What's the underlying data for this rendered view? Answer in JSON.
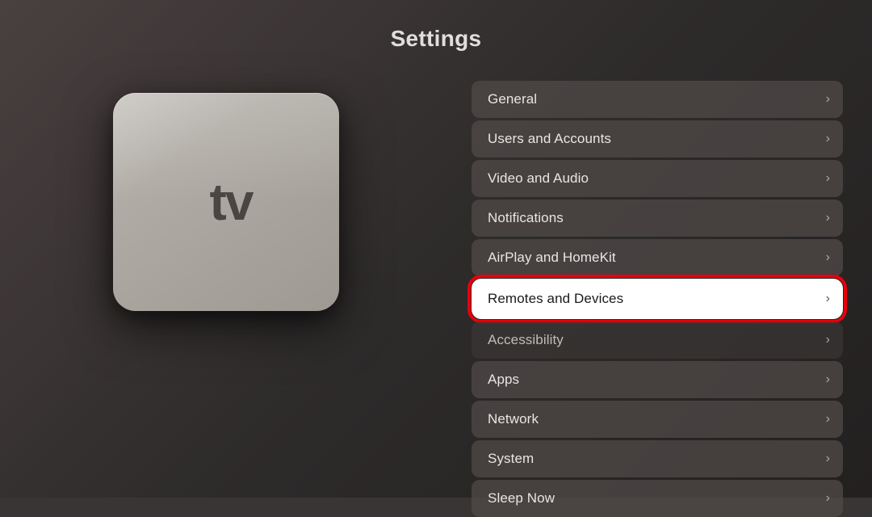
{
  "page": {
    "title": "Settings"
  },
  "settings": {
    "items": [
      {
        "id": "general",
        "label": "General",
        "highlighted": false,
        "dimmed": false
      },
      {
        "id": "users-and-accounts",
        "label": "Users and Accounts",
        "highlighted": false,
        "dimmed": false
      },
      {
        "id": "video-and-audio",
        "label": "Video and Audio",
        "highlighted": false,
        "dimmed": false
      },
      {
        "id": "notifications",
        "label": "Notifications",
        "highlighted": false,
        "dimmed": false
      },
      {
        "id": "airplay-and-homekit",
        "label": "AirPlay and HomeKit",
        "highlighted": false,
        "dimmed": false
      },
      {
        "id": "remotes-and-devices",
        "label": "Remotes and Devices",
        "highlighted": true,
        "dimmed": false
      },
      {
        "id": "accessibility",
        "label": "Accessibility",
        "highlighted": false,
        "dimmed": true
      },
      {
        "id": "apps",
        "label": "Apps",
        "highlighted": false,
        "dimmed": false
      },
      {
        "id": "network",
        "label": "Network",
        "highlighted": false,
        "dimmed": false
      },
      {
        "id": "system",
        "label": "System",
        "highlighted": false,
        "dimmed": false
      },
      {
        "id": "sleep-now",
        "label": "Sleep Now",
        "highlighted": false,
        "dimmed": false
      }
    ]
  },
  "device": {
    "apple_symbol": "",
    "tv_text": "tv"
  },
  "icons": {
    "chevron": "›"
  }
}
